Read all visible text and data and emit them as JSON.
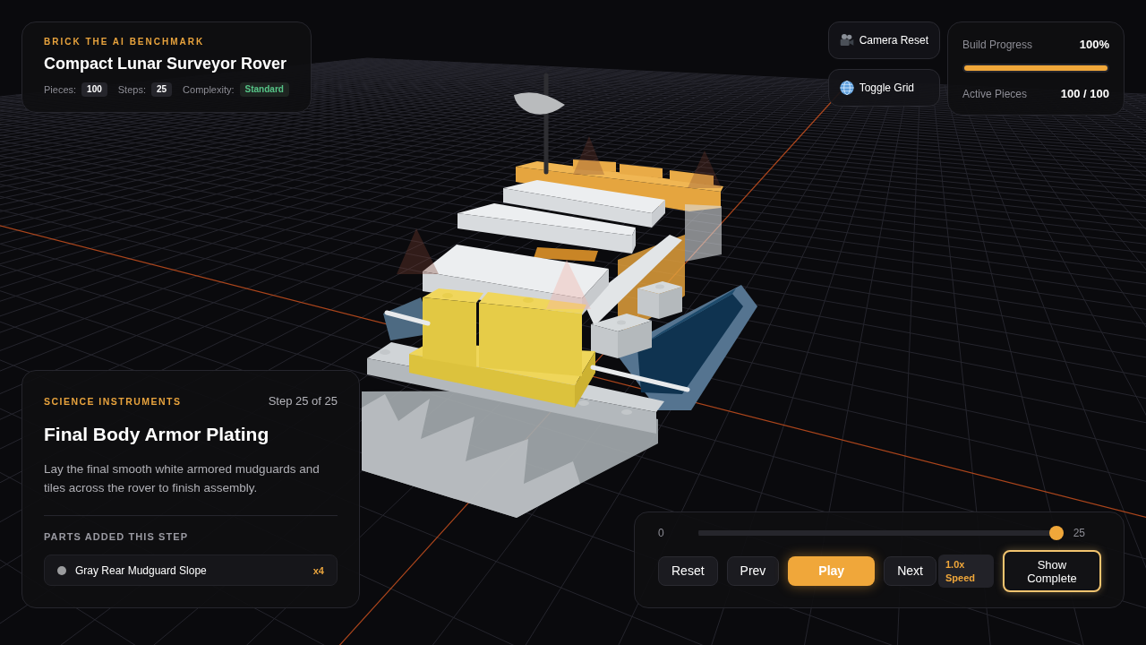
{
  "header": {
    "eyebrow": "BRICK THE AI BENCHMARK",
    "title": "Compact Lunar Surveyor Rover",
    "stats": [
      {
        "label": "Pieces:",
        "value": "100",
        "kind": "count"
      },
      {
        "label": "Steps:",
        "value": "25",
        "kind": "count"
      },
      {
        "label": "Complexity:",
        "value": "Standard",
        "kind": "level"
      }
    ]
  },
  "view_buttons": [
    {
      "label": "Camera Reset",
      "kind": "camera"
    },
    {
      "label": "Toggle Grid",
      "kind": "grid"
    }
  ],
  "progress": {
    "label": "Build Progress",
    "percent": "100%",
    "level": 1,
    "pieces_label": "Active Pieces",
    "pieces": "100 / 100"
  },
  "step": {
    "category": "SCIENCE INSTRUMENTS",
    "counter": "Step 25 of 25",
    "title": "Final Body Armor Plating",
    "description": "Lay the final smooth white armored mudguards and tiles across the rover to finish assembly.",
    "parts_heading": "PARTS ADDED THIS STEP",
    "parts": [
      {
        "name": "Gray Rear Mudguard Slope",
        "count": "x4",
        "color": "#9b9c9e"
      }
    ]
  },
  "playback": {
    "slider": {
      "min_label": "0",
      "max_label": "25",
      "level": 1
    },
    "buttons": [
      {
        "label": "Reset",
        "kind": "default"
      },
      {
        "label": "Prev",
        "kind": "default"
      },
      {
        "label": "Play",
        "kind": "primary"
      },
      {
        "label": "Next",
        "kind": "default"
      },
      {
        "label": "1.0x Speed",
        "kind": "speed"
      }
    ],
    "show_complete": {
      "label": "Show Complete",
      "on": true
    }
  }
}
